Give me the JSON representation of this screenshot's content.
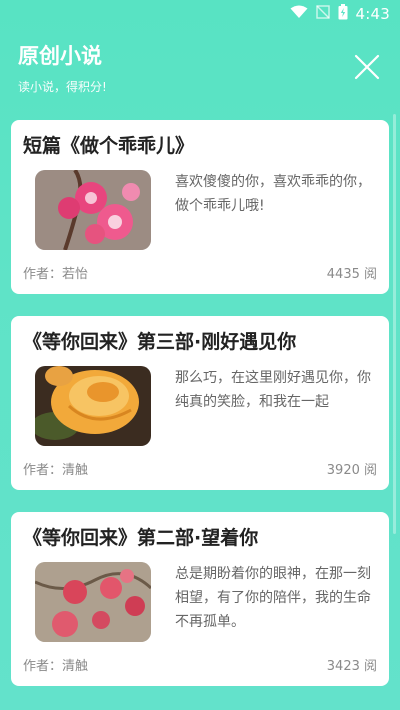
{
  "status_bar": {
    "time": "4:43",
    "icons": [
      "wifi-icon",
      "no-signal-icon",
      "battery-charging-icon"
    ]
  },
  "header": {
    "title": "原创小说",
    "subtitle": "读小说，得积分!",
    "close_icon": "close-icon"
  },
  "colors": {
    "background": "#5fe3c7",
    "card": "#ffffff",
    "title_text": "#222222",
    "desc_text": "#666666",
    "meta_text": "#8a8a8a"
  },
  "stories": [
    {
      "title": "短篇《做个乖乖儿》",
      "description": "喜欢傻傻的你，喜欢乖乖的你，做个乖乖儿哦!",
      "author": "作者：若怡",
      "reads": "4435 阅",
      "thumbnail": "pink-blossom-image"
    },
    {
      "title": "《等你回来》第三部·刚好遇见你",
      "description": "那么巧，在这里刚好遇见你，你纯真的笑脸，和我在一起",
      "author": "作者：清触",
      "reads": "3920 阅",
      "thumbnail": "yellow-rose-image"
    },
    {
      "title": "《等你回来》第二部·望着你",
      "description": "总是期盼着你的眼神，在那一刻相望，有了你的陪伴，我的生命不再孤单。",
      "author": "作者：清触",
      "reads": "3423 阅",
      "thumbnail": "red-flowers-painting-image"
    }
  ]
}
